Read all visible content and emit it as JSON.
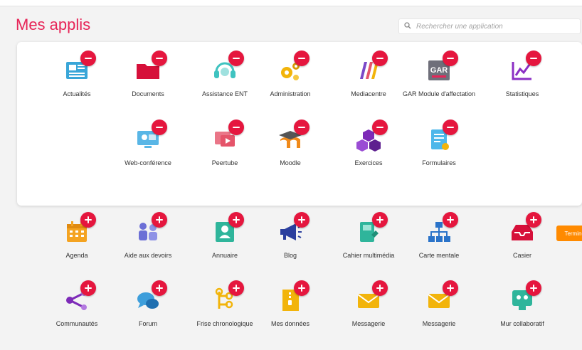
{
  "header": {
    "title": "Mes applis",
    "search_placeholder": "Rechercher une application",
    "search_value": ""
  },
  "active_apps": [
    {
      "name": "Actualités",
      "icon": "newspaper-icon",
      "color": "#39a6d8"
    },
    {
      "name": "Documents",
      "icon": "folder-icon",
      "color": "#d6103a"
    },
    {
      "name": "Assistance ENT",
      "icon": "headset-icon",
      "color": "#3fc3c0"
    },
    {
      "name": "Administration",
      "icon": "gears-icon",
      "color": "#f2b40b"
    },
    {
      "name": "Mediacentre",
      "icon": "mediacentre-icon",
      "color": "#7a48c8"
    },
    {
      "name": "GAR Module d'affectation",
      "icon": "gar-icon",
      "color": "#6f6f7a",
      "icon_text": "GAR"
    },
    {
      "name": "Statistiques",
      "icon": "chart-line-icon",
      "color": "#8b2fc4"
    },
    {
      "name": "Web-conférence",
      "icon": "videoconference-icon",
      "color": "#59b6e6"
    },
    {
      "name": "Peertube",
      "icon": "peertube-icon",
      "color": "#e5546a"
    },
    {
      "name": "Moodle",
      "icon": "moodle-icon",
      "color": "#f08a1a"
    },
    {
      "name": "Exercices",
      "icon": "cubes-icon",
      "color": "#7d2ab8"
    },
    {
      "name": "Formulaires",
      "icon": "form-icon",
      "color": "#4db7ea"
    }
  ],
  "finish_button": "Terminer",
  "available_apps": [
    {
      "name": "Agenda",
      "icon": "calendar-icon",
      "color": "#f4a321"
    },
    {
      "name": "Aide aux devoirs",
      "icon": "people-icon",
      "color": "#6c6fd6"
    },
    {
      "name": "Annuaire",
      "icon": "contact-card-icon",
      "color": "#2fb59b"
    },
    {
      "name": "Blog",
      "icon": "megaphone-icon",
      "color": "#2b3f9e"
    },
    {
      "name": "Cahier multimédia",
      "icon": "multimedia-notebook-icon",
      "color": "#2fb59b"
    },
    {
      "name": "Carte mentale",
      "icon": "sitemap-icon",
      "color": "#2a73c9"
    },
    {
      "name": "Casier",
      "icon": "inbox-tray-icon",
      "color": "#d6103a"
    },
    {
      "name": "Communautés",
      "icon": "share-nodes-icon",
      "color": "#7d2ab8"
    },
    {
      "name": "Forum",
      "icon": "chat-bubbles-icon",
      "color": "#3d9edb"
    },
    {
      "name": "Frise chronologique",
      "icon": "timeline-icon",
      "color": "#f2b40b"
    },
    {
      "name": "Mes données",
      "icon": "zip-file-icon",
      "color": "#f2b40b"
    },
    {
      "name": "Messagerie",
      "icon": "envelope-icon",
      "color": "#f2b40b"
    },
    {
      "name": "Messagerie",
      "icon": "envelope-icon",
      "color": "#f2b40b"
    },
    {
      "name": "Mur collaboratif",
      "icon": "collab-wall-icon",
      "color": "#2fb59b"
    }
  ],
  "colors": {
    "accent": "#e72457",
    "badge": "#e5163e",
    "finish": "#ff8a00"
  }
}
